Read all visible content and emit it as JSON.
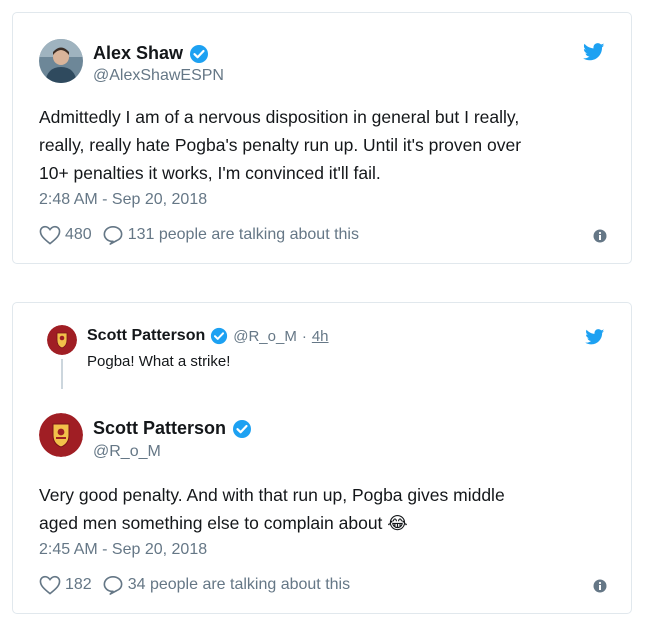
{
  "tweets": [
    {
      "name": "Alex Shaw",
      "handle": "@AlexShawESPN",
      "text_lines": [
        "Admittedly I am of a nervous disposition in general but I really,",
        "really, really hate Pogba's penalty run up. Until it's proven over",
        "10+ penalties it works, I'm convinced it'll fail."
      ],
      "timestamp": "2:48 AM - Sep 20, 2018",
      "likes": "480",
      "talking": "131 people are talking about this"
    },
    {
      "parent": {
        "name": "Scott Patterson",
        "handle": "@R_o_M",
        "separator": "·",
        "age": "4h",
        "text": "Pogba! What a strike!"
      },
      "name": "Scott Patterson",
      "handle": "@R_o_M",
      "text_lines": [
        "Very good penalty. And with that run up, Pogba gives middle",
        "aged men something else to complain about"
      ],
      "emoji": "😂",
      "timestamp": "2:45 AM - Sep 20, 2018",
      "likes": "182",
      "talking": "34 people are talking about this"
    }
  ],
  "icons": {
    "verified": "verified-badge-icon",
    "twitter": "twitter-bird-icon",
    "heart": "heart-icon",
    "reply": "speech-bubble-icon",
    "info": "info-icon"
  },
  "colors": {
    "twitter_blue": "#1da1f2",
    "text_primary": "#14171a",
    "text_secondary": "#657786",
    "border": "#e1e8ed",
    "united_crest_red": "#a01e24"
  }
}
